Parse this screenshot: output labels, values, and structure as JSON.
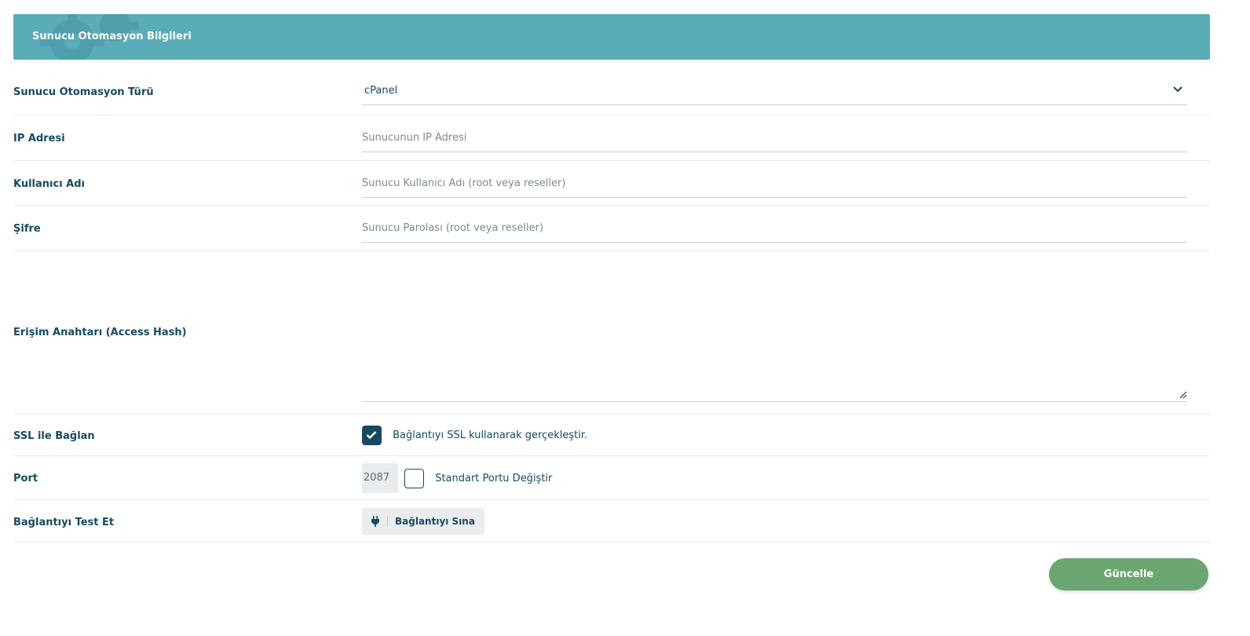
{
  "header": {
    "title": "Sunucu Otomasyon Bilgileri",
    "icon": "gear-icon"
  },
  "form": {
    "type": {
      "label": "Sunucu Otomasyon Türü",
      "value": "cPanel"
    },
    "ip": {
      "label": "IP Adresi",
      "placeholder": "Sunucunun IP Adresi"
    },
    "username": {
      "label": "Kullanıcı Adı",
      "placeholder": "Sunucu Kullanıcı Adı (root veya reseller)"
    },
    "password": {
      "label": "Şifre",
      "placeholder": "Sunucu Parolası (root veya reseller)"
    },
    "access_hash": {
      "label": "Erişim Anahtarı (Access Hash)",
      "value": ""
    },
    "ssl": {
      "label": "SSL ile Bağlan",
      "checkbox_text": "Bağlantıyı SSL kullanarak gerçekleştir.",
      "checked": true
    },
    "port": {
      "label": "Port",
      "value": "2087",
      "checkbox_text": "Standart Portu Değiştir",
      "checked": false
    },
    "test": {
      "label": "Bağlantıyı Test Et",
      "button_label": "Bağlantıyı Sına",
      "icon": "plug-icon"
    }
  },
  "actions": {
    "update_label": "Güncelle"
  },
  "colors": {
    "header_bg": "#5aacb8",
    "primary": "#164a61",
    "update_bg": "#6ba571"
  }
}
